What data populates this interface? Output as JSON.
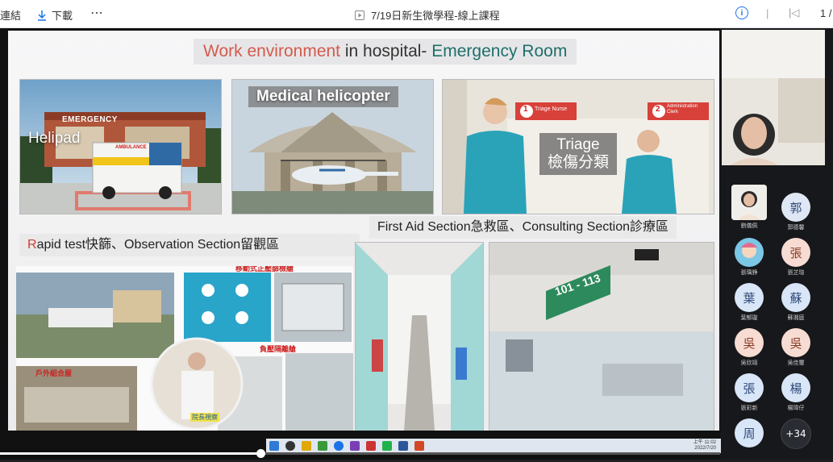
{
  "toolbar": {
    "copy_link_label": "複製連結",
    "copy_link_visible": "連結",
    "download_label": "下載",
    "more_label": "⋯",
    "doc_title": "7/19日新生微學程-線上課程",
    "page_number": "1 /"
  },
  "slide": {
    "title_part1": "Work environment",
    "title_part2": " in hospital- ",
    "title_part3": "Emergency Room",
    "helipad_label": "Helipad",
    "emergency_sign": "EMERGENCY",
    "ambulance_sign": "AMBULANCE",
    "helicopter_label": "Medical helicopter",
    "triage_label_en": "Triage",
    "triage_label_zh": "檢傷分類",
    "triage_nurse_sign": "Triage Nurse",
    "admin_clerk_sign": "Administration Clerk",
    "sign_1": "1",
    "sign_2": "2",
    "first_aid_label": "First Aid Section急救區、Consulting Section診療區",
    "rapid_r": "R",
    "rapid_label_rest": "apid test快篩、Observation Section留觀區",
    "mobile_booth_label": "移動式正壓篩檢艙",
    "negative_booth_label": "負壓隔離艙",
    "outdoor_house_label": "戶外組合屋",
    "director_caption": "院長視察",
    "room_sign": "101 - 113"
  },
  "participants": [
    {
      "initial": "",
      "name": "劉儀佩",
      "color": "#e8e8e8",
      "text": "#333"
    },
    {
      "initial": "郭",
      "name": "郭德馨",
      "color": "#dfe7f5",
      "text": "#2e4a7a"
    },
    {
      "initial": "",
      "name": "張瑀錚",
      "color": "#7cc6e6",
      "text": "#fff"
    },
    {
      "initial": "張",
      "name": "張芷瑄",
      "color": "#f7dcd3",
      "text": "#8a3b24"
    },
    {
      "initial": "葉",
      "name": "葉郁璇",
      "color": "#d9e6f7",
      "text": "#2e4a7a"
    },
    {
      "initial": "蘇",
      "name": "蘇湘庭",
      "color": "#d9e6f7",
      "text": "#2e4a7a"
    },
    {
      "initial": "吳",
      "name": "吳欣翊",
      "color": "#f7dcd3",
      "text": "#8a3b24"
    },
    {
      "initial": "吳",
      "name": "吳佳璽",
      "color": "#f7dcd3",
      "text": "#8a3b24"
    },
    {
      "initial": "張",
      "name": "張彩新",
      "color": "#d9e6f7",
      "text": "#2e4a7a"
    },
    {
      "initial": "楊",
      "name": "楊瑋仔",
      "color": "#d9e6f7",
      "text": "#2e4a7a"
    },
    {
      "initial": "周",
      "name": "",
      "color": "#d9e6f7",
      "text": "#2e4a7a"
    },
    {
      "initial": "+34",
      "name": "",
      "color": "#2a2c33",
      "text": "#fff"
    }
  ],
  "taskbar": {
    "time": "上午 11:02",
    "date": "2022/7/20"
  }
}
